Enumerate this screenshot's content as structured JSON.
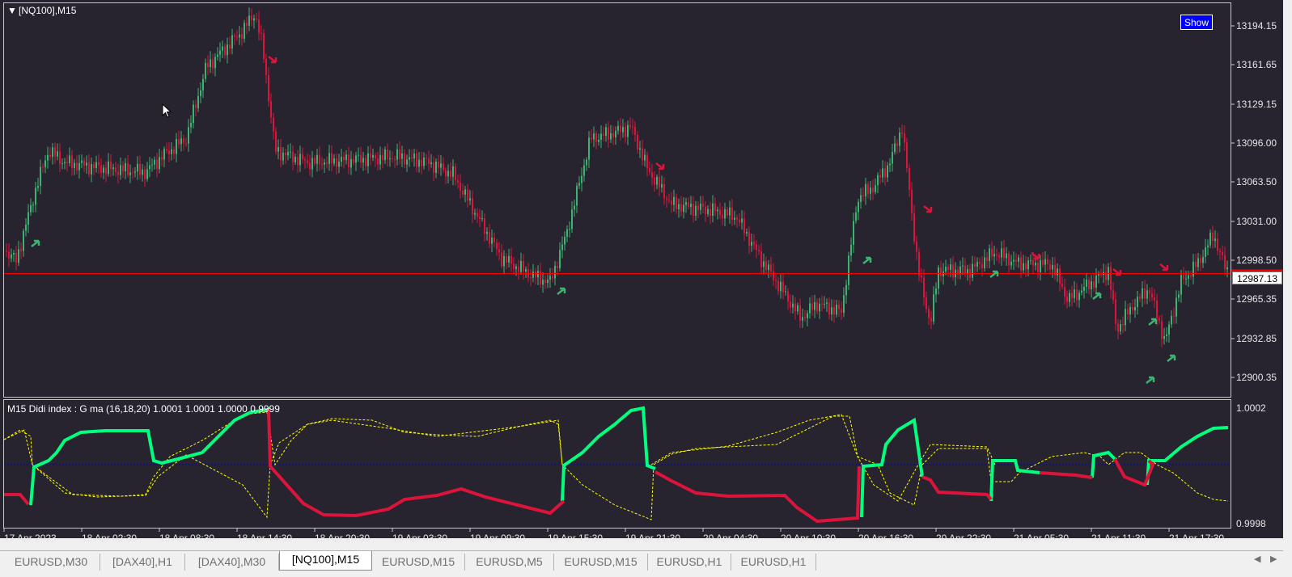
{
  "chart": {
    "title": "[NQ100],M15",
    "show_label": "Show",
    "current_price": "12987.13",
    "price_labels": [
      "13194.15",
      "13161.65",
      "13129.15",
      "13096.00",
      "13063.50",
      "13031.00",
      "12998.50",
      "12965.35",
      "12932.85",
      "12900.35"
    ],
    "indicator_title": "M15 Didi index : G ma (16,18,20)  1.0001  1.0001  1.0000  0.9999",
    "indicator_labels": [
      "1.0002",
      "0.9998"
    ],
    "time_labels": [
      "17 Apr 2023",
      "18 Apr 02:30",
      "18 Apr 08:30",
      "18 Apr 14:30",
      "18 Apr 20:30",
      "19 Apr 03:30",
      "19 Apr 09:30",
      "19 Apr 15:30",
      "19 Apr 21:30",
      "20 Apr 04:30",
      "20 Apr 10:30",
      "20 Apr 16:30",
      "20 Apr 22:30",
      "21 Apr 05:30",
      "21 Apr 11:30",
      "21 Apr 17:30"
    ],
    "colors": {
      "background": "#27232f",
      "bull": "#3cb371",
      "bear": "#dc143c",
      "didi_green": "#00ff7f",
      "didi_red": "#dc143c",
      "yellow": "#ffff00",
      "price_line": "#ff0000",
      "zero_line": "#0000cd"
    }
  },
  "tabs": [
    {
      "label": "EURUSD,M30",
      "active": false
    },
    {
      "label": "[DAX40],H1",
      "active": false
    },
    {
      "label": "[DAX40],M30",
      "active": false
    },
    {
      "label": "[NQ100],M15",
      "active": true
    },
    {
      "label": "EURUSD,M15",
      "active": false
    },
    {
      "label": "EURUSD,M5",
      "active": false
    },
    {
      "label": "EURUSD,M15",
      "active": false
    },
    {
      "label": "EURUSD,H1",
      "active": false
    },
    {
      "label": "EURUSD,H1",
      "active": false
    }
  ],
  "icons": {
    "collapse": "triangle-down-icon",
    "scroll_left": "chevron-left-icon",
    "scroll_right": "chevron-right-icon",
    "cursor": "mouse-pointer-icon"
  }
}
